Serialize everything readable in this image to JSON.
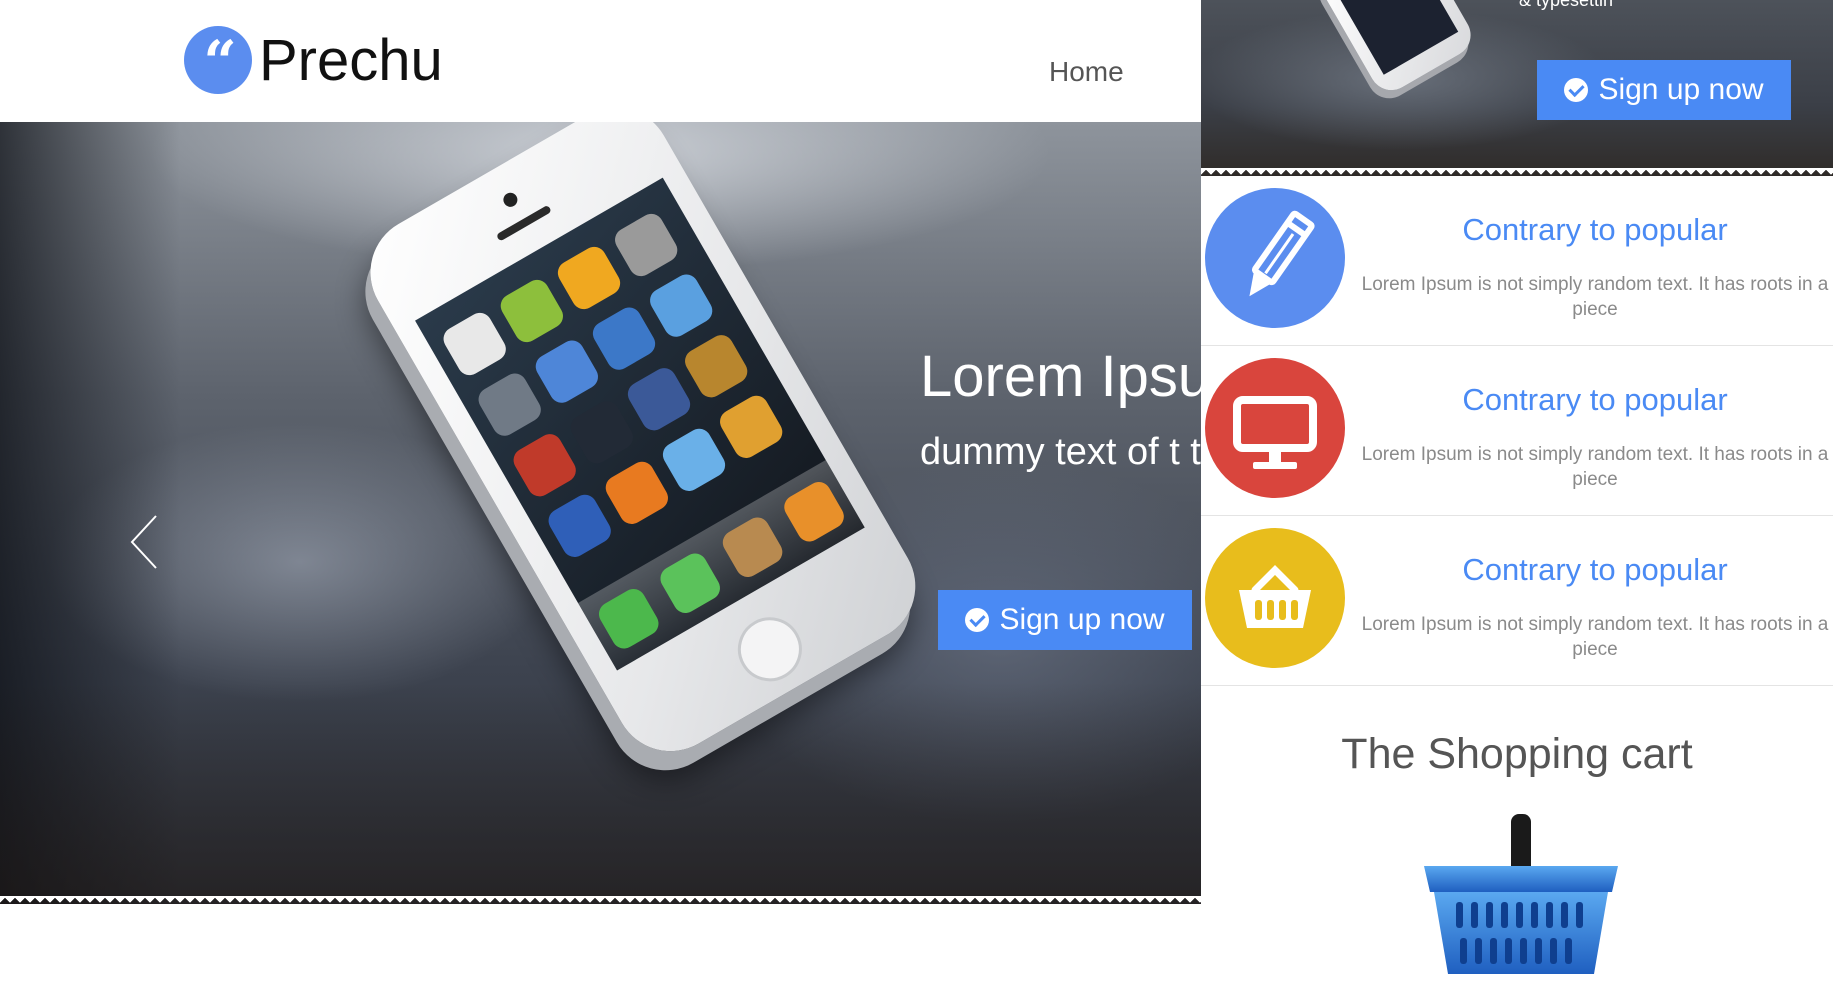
{
  "brand": {
    "logo_glyph": "“",
    "name": "Prechu",
    "color": "#5b8def"
  },
  "nav": {
    "items": [
      {
        "label": "Home"
      }
    ]
  },
  "hero": {
    "title": "Lorem Ipsu",
    "subtitle": "dummy text of t typesettin",
    "cta_label": "Sign up now",
    "accent": "#4a8af4"
  },
  "right_panel": {
    "hero_text": "& typesettin",
    "cta_label": "Sign up now",
    "features": [
      {
        "icon": "pencil-icon",
        "color": "#5b8def",
        "title": "Contrary to popular",
        "text": "Lorem Ipsum is not simply random text. It has roots in a piece"
      },
      {
        "icon": "monitor-icon",
        "color": "#d9453d",
        "title": "Contrary to popular",
        "text": "Lorem Ipsum is not simply random text. It has roots in a piece"
      },
      {
        "icon": "basket-icon",
        "color": "#e8bd1c",
        "title": "Contrary to popular",
        "text": "Lorem Ipsum is not simply random text. It has roots in a piece"
      }
    ],
    "cart_title": "The Shopping cart",
    "cart_image": "shopping-basket-icon"
  }
}
